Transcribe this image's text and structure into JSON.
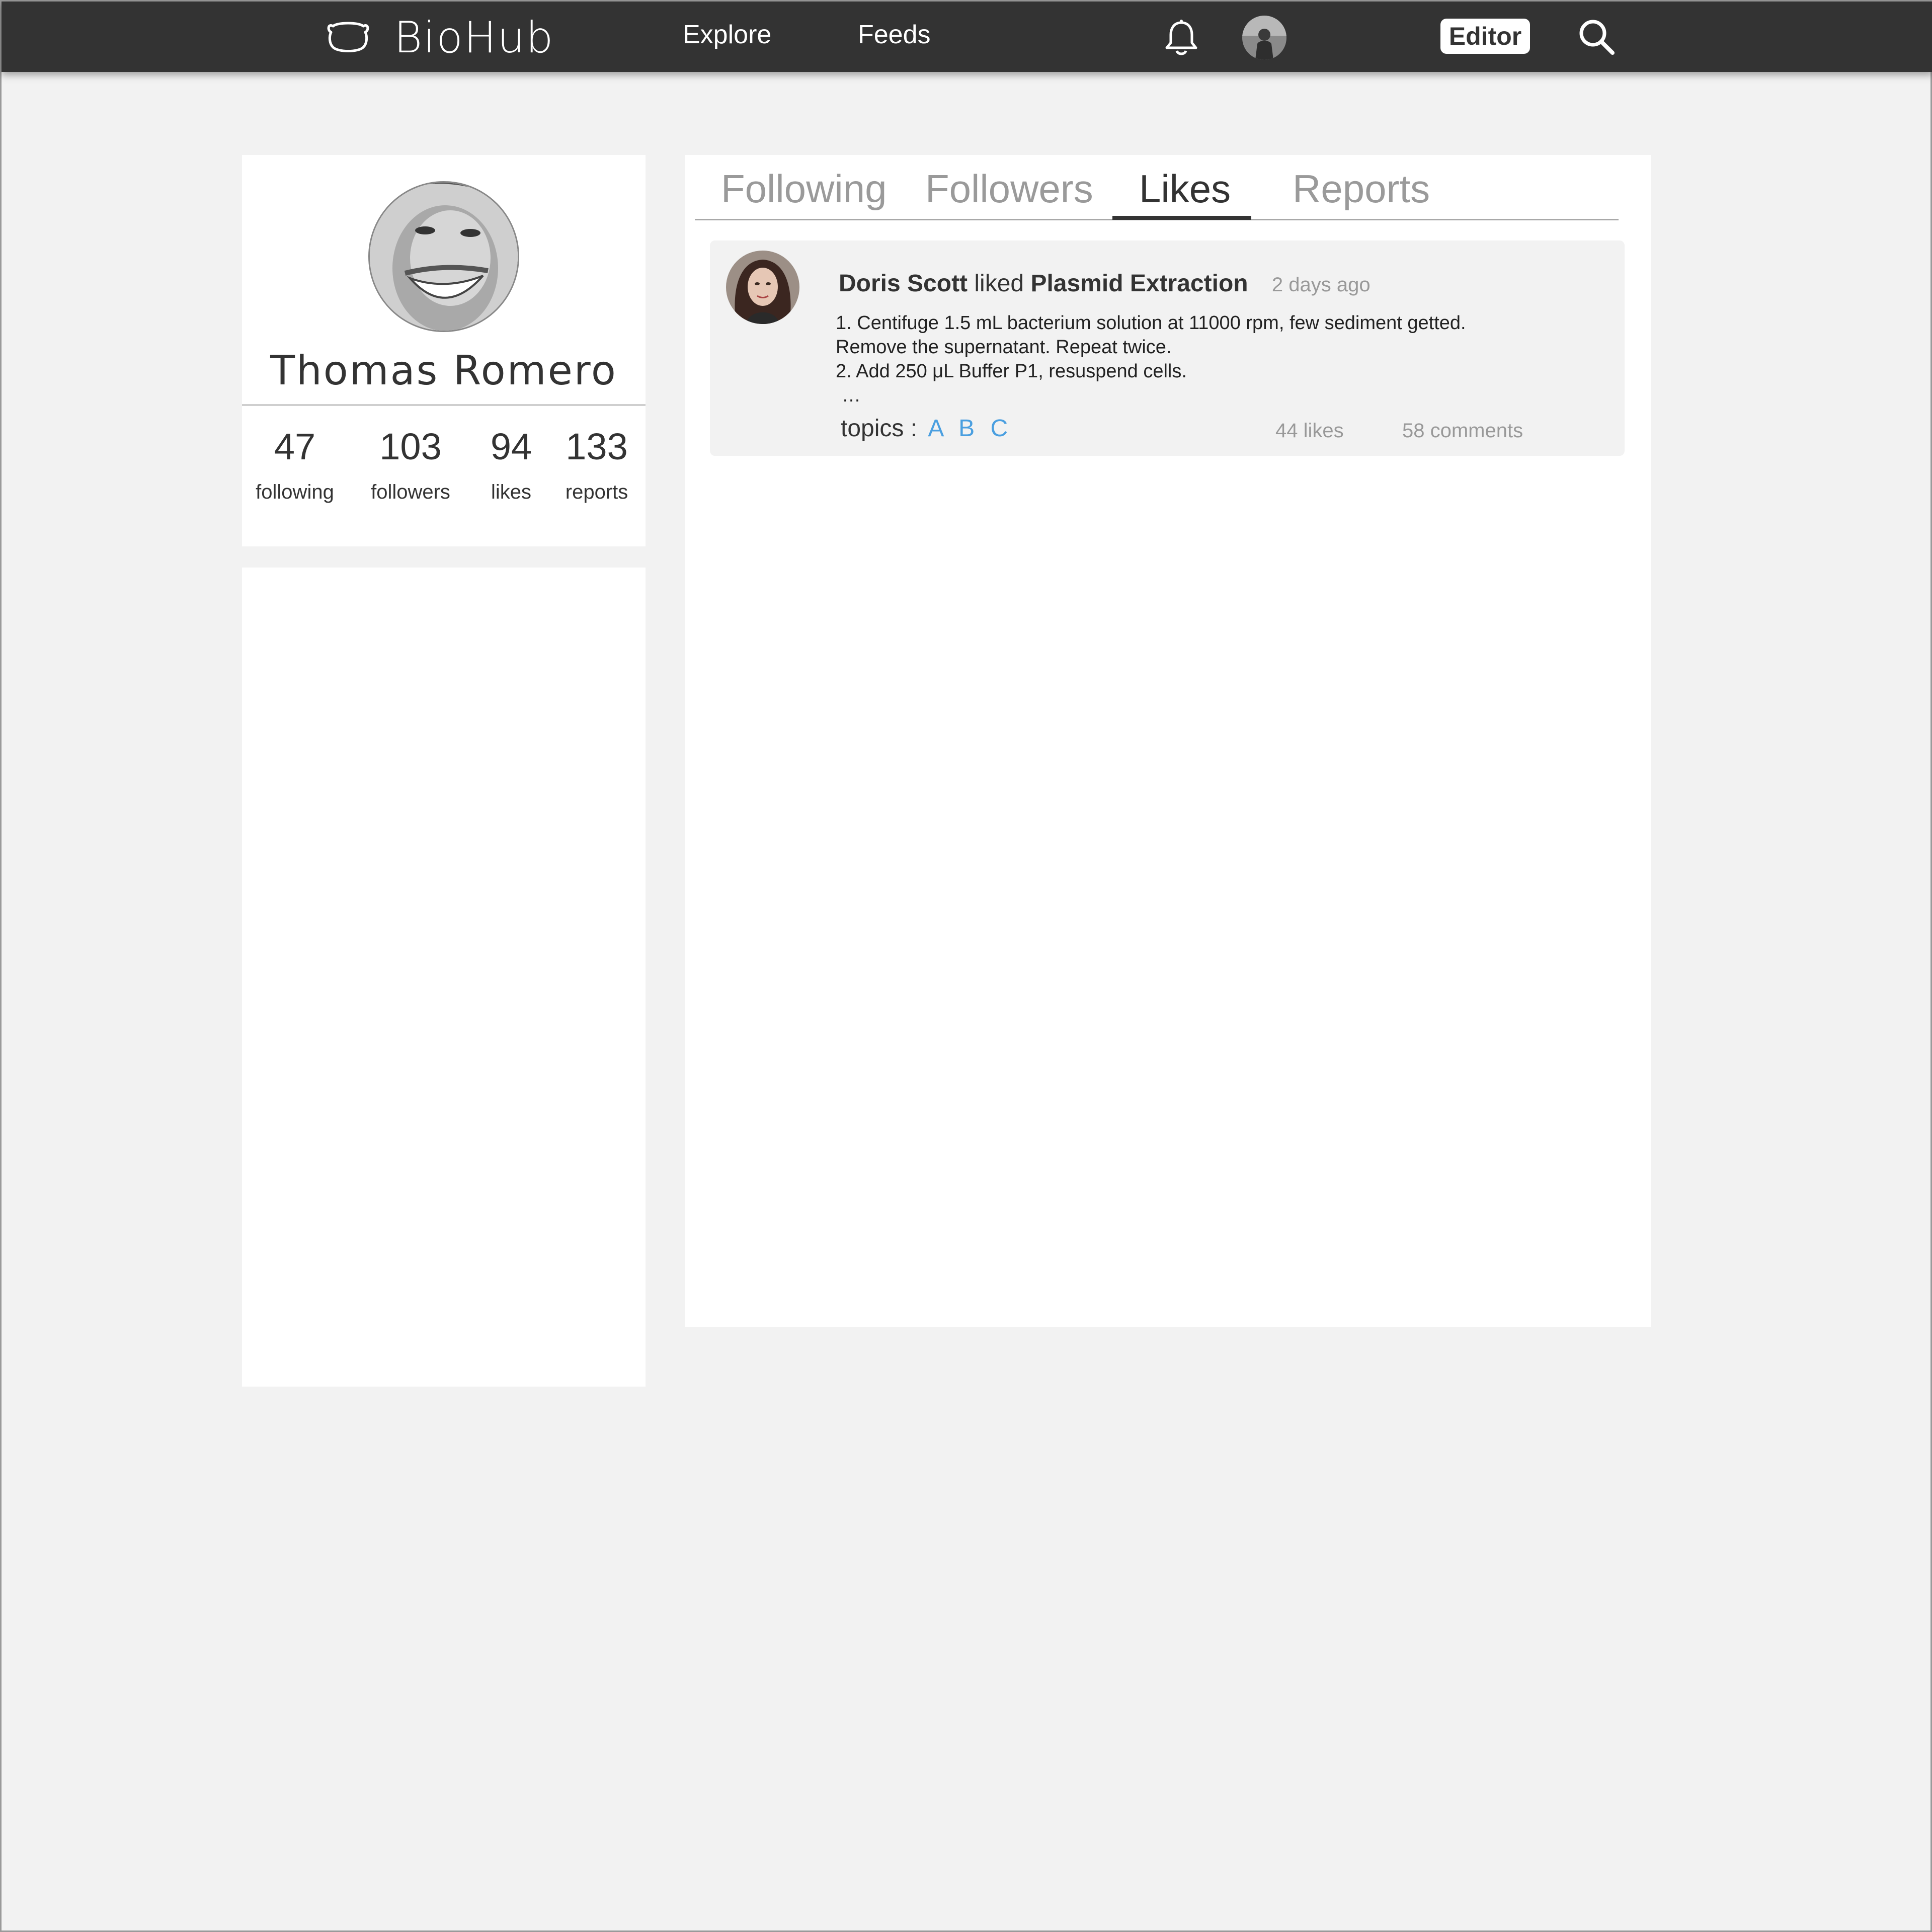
{
  "header": {
    "logo_text": "BioHub",
    "nav": {
      "explore": "Explore",
      "feeds": "Feeds"
    },
    "editor_label": "Editor",
    "icons": [
      "bear-logo-icon",
      "bell-icon",
      "user-avatar",
      "search-icon"
    ]
  },
  "profile": {
    "name": "Thomas Romero",
    "stats": [
      {
        "value": "47",
        "label": "following"
      },
      {
        "value": "103",
        "label": "followers"
      },
      {
        "value": "94",
        "label": "likes"
      },
      {
        "value": "133",
        "label": "reports"
      }
    ]
  },
  "tabs": [
    {
      "label": "Following",
      "active": false
    },
    {
      "label": "Followers",
      "active": false
    },
    {
      "label": "Likes",
      "active": true
    },
    {
      "label": "Reports",
      "active": false
    }
  ],
  "activity": {
    "user": "Doris Scott",
    "verb": "liked",
    "item": "Plasmid Extraction",
    "time": "2 days ago",
    "body": [
      "1. Centifuge 1.5 mL bacterium solution at 11000 rpm, few sediment getted.",
      "Remove the supernatant. Repeat twice.",
      "2. Add 250 μL Buffer P1, resuspend cells.",
      "…"
    ],
    "topics_label": "topics :",
    "topics": [
      "A",
      "B",
      "C"
    ],
    "likes": "44 likes",
    "comments": "58 comments"
  },
  "colors": {
    "topbar": "#333333",
    "background": "#f2f2f2",
    "link": "#4a9fe0",
    "muted": "#999999"
  }
}
